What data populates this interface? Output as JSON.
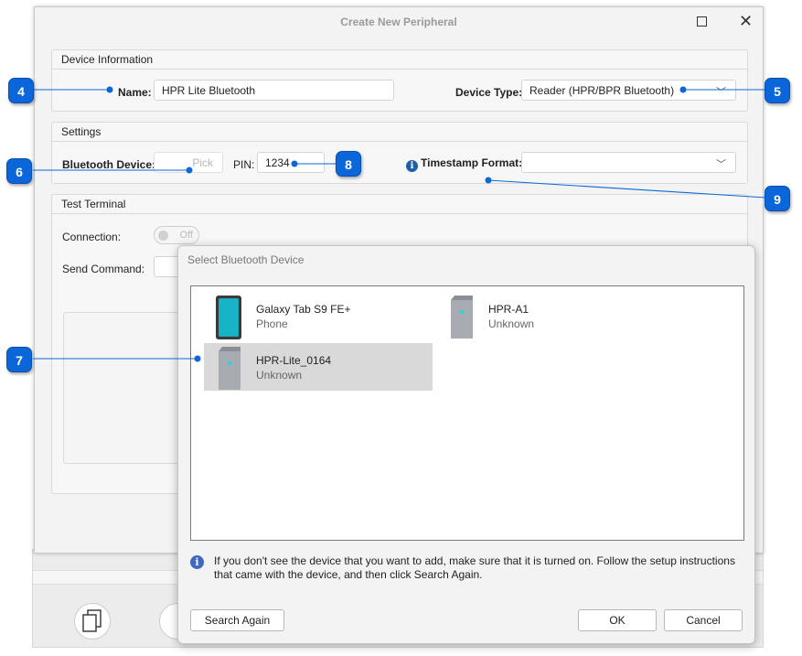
{
  "window": {
    "title": "Create New Peripheral"
  },
  "device_info": {
    "group_title": "Device Information",
    "name_label": "Name:",
    "name_value": "HPR Lite Bluetooth",
    "type_label": "Device Type:",
    "type_value": "Reader (HPR/BPR Bluetooth)"
  },
  "settings": {
    "group_title": "Settings",
    "bt_label": "Bluetooth Device:",
    "pick_label": "Pick",
    "pin_label": "PIN:",
    "pin_value": "1234",
    "timestamp_label": "Timestamp Format:",
    "timestamp_value": ""
  },
  "terminal": {
    "group_title": "Test Terminal",
    "connection_label": "Connection:",
    "toggle_label": "Off",
    "send_label": "Send Command:"
  },
  "dialog": {
    "title": "Select Bluetooth Device",
    "devices": [
      {
        "name": "Galaxy Tab S9 FE+",
        "type": "Phone",
        "icon": "phone-icon",
        "selected": false
      },
      {
        "name": "HPR-A1",
        "type": "Unknown",
        "icon": "device-tower-icon",
        "selected": false
      },
      {
        "name": "HPR-Lite_0164",
        "type": "Unknown",
        "icon": "device-tower-icon",
        "selected": true
      }
    ],
    "info_text": "If you don't see the device that you want to add, make sure that it is turned on. Follow the setup instructions that came with the device, and then click Search Again.",
    "search_again": "Search Again",
    "ok": "OK",
    "cancel": "Cancel"
  },
  "callouts": [
    "4",
    "5",
    "6",
    "7",
    "8",
    "9"
  ],
  "colors": {
    "callout": "#0b67d9",
    "info": "#4267c2",
    "selection": "#d9d9d9"
  }
}
